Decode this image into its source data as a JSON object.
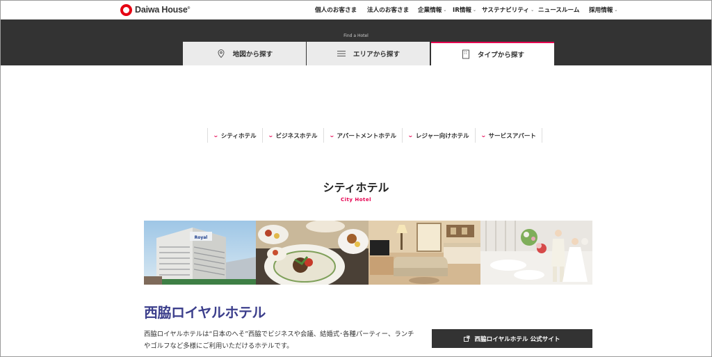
{
  "header": {
    "logo_text": "Daiwa House",
    "logo_mark": "®",
    "nav": [
      {
        "label": "個人のお客さま",
        "caret": ""
      },
      {
        "label": "法人のお客さま",
        "caret": ""
      },
      {
        "label": "企業情報",
        "caret": "⌄"
      },
      {
        "label": "IR情報",
        "caret": "⌄"
      },
      {
        "label": "サステナビリティ",
        "caret": "⌄"
      },
      {
        "label": "ニュースルーム",
        "caret": ""
      },
      {
        "label": "採用情報",
        "caret": "⌄"
      }
    ]
  },
  "band": {
    "subtitle": "Find a Hotel"
  },
  "tabs": [
    {
      "label": "地図から探す",
      "icon": "map-pin-icon"
    },
    {
      "label": "エリアから探す",
      "icon": "list-icon"
    },
    {
      "label": "タイプから探す",
      "icon": "document-icon",
      "active": true
    }
  ],
  "filters": [
    "シティホテル",
    "ビジネスホテル",
    "アパートメントホテル",
    "レジャー向けホテル",
    "サービスアパート"
  ],
  "section": {
    "title": "シティホテル",
    "subtitle": "City Hotel"
  },
  "hotel": {
    "name": "西脇ロイヤルホテル",
    "description": "西脇ロイヤルホテルは“日本のへそ”西脇でビジネスや会議、結婚式･各種パーティー、ランチやゴルフなど多様にご利用いただけるホテルです。",
    "site_button": "西脇ロイヤルホテル 公式サイト",
    "building_sign": "Royal"
  },
  "colors": {
    "accent": "#e60050",
    "brand_red": "#e60012",
    "hotel_name": "#3c3f8c",
    "dark_band": "#333333"
  }
}
